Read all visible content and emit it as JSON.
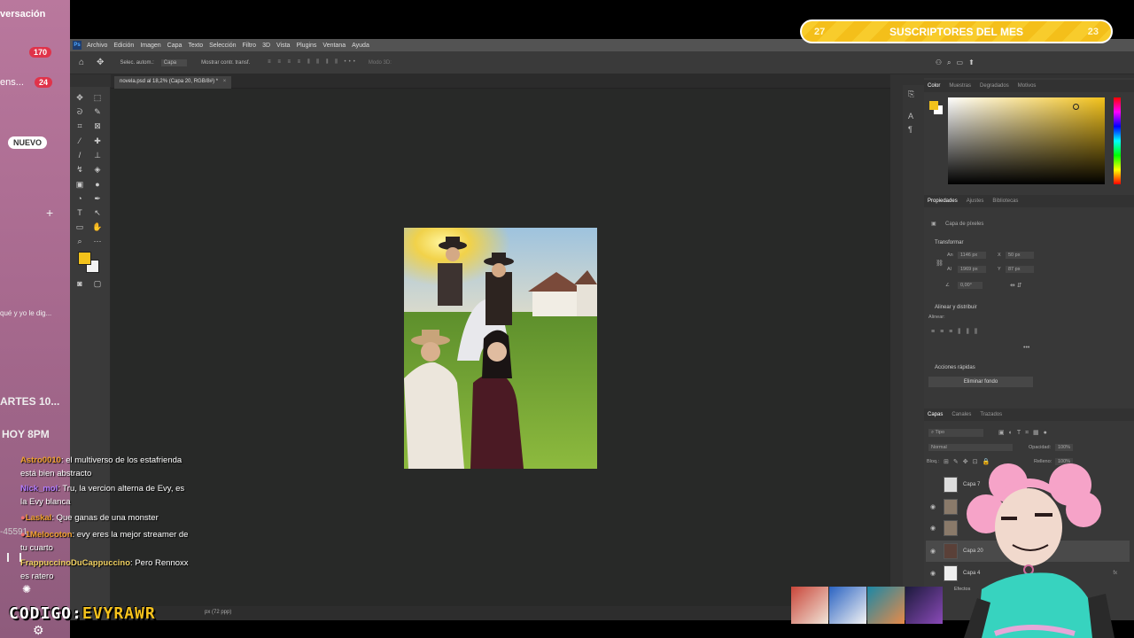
{
  "stream_sidebar": {
    "conversation_label": "versación",
    "badge_1": "170",
    "tab_2_label": "ens...",
    "badge_2": "24",
    "new_pill": "NUEVO",
    "plus": "+",
    "snippet": "qué y yo le dig...",
    "schedule_day": "ARTES 10...",
    "schedule_time": "HOY 8PM",
    "counter": "-45591"
  },
  "subscriber_banner": {
    "left_count": "27",
    "title": "SUSCRIPTORES DEL MES",
    "right_count": "23"
  },
  "photoshop": {
    "menu": [
      "Archivo",
      "Edición",
      "Imagen",
      "Capa",
      "Texto",
      "Selección",
      "Filtro",
      "3D",
      "Vista",
      "Plugins",
      "Ventana",
      "Ayuda"
    ],
    "options": {
      "auto_select": "Selec. autom.:",
      "auto_select_value": "Capa",
      "transform_controls": "Mostrar contr. transf.",
      "mode_3d": "Modo 3D:"
    },
    "doc_tab": "novela.psd al 18,2% (Capa 20, RGB/8#) *",
    "status": "px (72 ppp)",
    "color_panel": {
      "tabs": [
        "Color",
        "Muestras",
        "Degradados",
        "Motivos"
      ],
      "foreground": "#f3c21b"
    },
    "properties_panel": {
      "tabs": [
        "Propiedades",
        "Ajustes",
        "Bibliotecas"
      ],
      "layer_type": "Capa de píxeles",
      "transform_title": "Transformar",
      "width_label": "An",
      "width_value": "1146 px",
      "x_label": "X",
      "x_value": "50 px",
      "height_label": "Al",
      "height_value": "1969 px",
      "y_label": "Y",
      "y_value": "87 px",
      "angle_value": "0,00°",
      "align_title": "Alinear y distribuir",
      "align_label": "Alinear:",
      "quick_actions": "Acciones rápidas",
      "remove_bg": "Eliminar fondo"
    },
    "layers_panel": {
      "tabs": [
        "Capas",
        "Canales",
        "Trazados"
      ],
      "filter": "Tipo",
      "blend_mode": "Normal",
      "opacity_label": "Opacidad:",
      "opacity_value": "100%",
      "lock_label": "Bloq.:",
      "fill_label": "Relleno:",
      "fill_value": "100%",
      "layers": [
        {
          "name": "Capa 7"
        },
        {
          "name": "Capa 20"
        },
        {
          "name": "Capa 4"
        }
      ],
      "effects_label": "Efectos"
    }
  },
  "chat": [
    {
      "user": "Astro0010",
      "color": "#f0a030",
      "text": ": el multiverso de los estafrienda está bien abstracto"
    },
    {
      "user": "Nick_mol",
      "color": "#b47cff",
      "text": ": Tru, la vercion alterna de Evy, es la Evy blanca"
    },
    {
      "user": "Laskal",
      "color": "#f0a030",
      "text": ": Que ganas de una monster"
    },
    {
      "user": "1Melocoton",
      "color": "#f0a030",
      "text": ": evy eres la mejor streamer de tu cuarto"
    },
    {
      "user": "FrappuccinoDuCappuccino",
      "color": "#f0d060",
      "text": ": Pero Rennoxx es ratero"
    }
  ],
  "codigo": {
    "label": "CODIGO:",
    "code": "EVYRAWR"
  }
}
